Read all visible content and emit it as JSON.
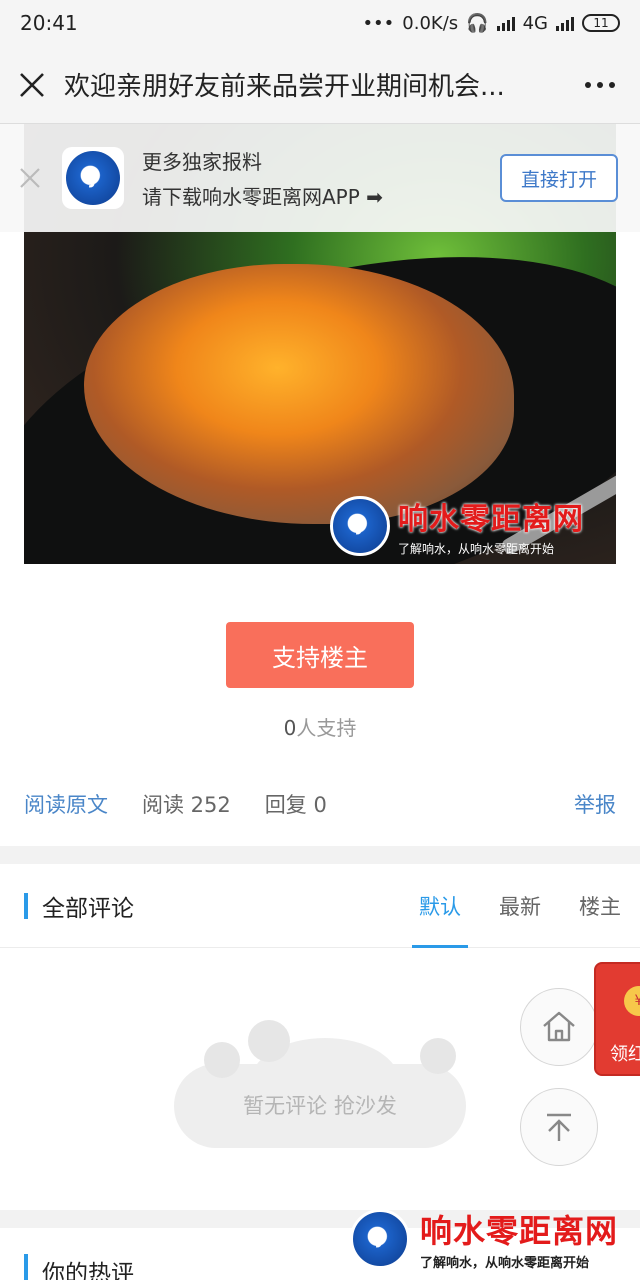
{
  "status_bar": {
    "time": "20:41",
    "network_speed": "0.0K/s",
    "network_type": "4G",
    "battery": "11"
  },
  "header": {
    "title": "欢迎亲朋好友前来品尝开业期间机会..."
  },
  "app_banner": {
    "line1": "更多独家报料",
    "line2": "请下载响水零距离网APP ➡",
    "open_label": "直接打开"
  },
  "hero_image": {
    "watermark_title": "响水零距离网",
    "watermark_sub": "了解响水，从响水零距离开始"
  },
  "support": {
    "button_label": "支持楼主",
    "count": "0",
    "count_suffix": "人支持"
  },
  "meta": {
    "read_original": "阅读原文",
    "reads": "阅读 252",
    "replies": "回复 0",
    "report": "举报"
  },
  "comments": {
    "title": "全部评论",
    "tabs": [
      {
        "label": "默认",
        "active": true
      },
      {
        "label": "最新",
        "active": false
      },
      {
        "label": "楼主",
        "active": false
      }
    ],
    "empty_text": "暂无评论 抢沙发"
  },
  "red_packet": {
    "label": "领红"
  },
  "hot_comments": {
    "title": "你的热评"
  },
  "footer_watermark": {
    "title": "响水零距离网",
    "sub": "了解响水，从响水零距离开始"
  },
  "colors": {
    "accent": "#2a9ae8",
    "support_button": "#f96f5b",
    "link": "#4a86c8",
    "watermark_red": "#e31b1b"
  }
}
